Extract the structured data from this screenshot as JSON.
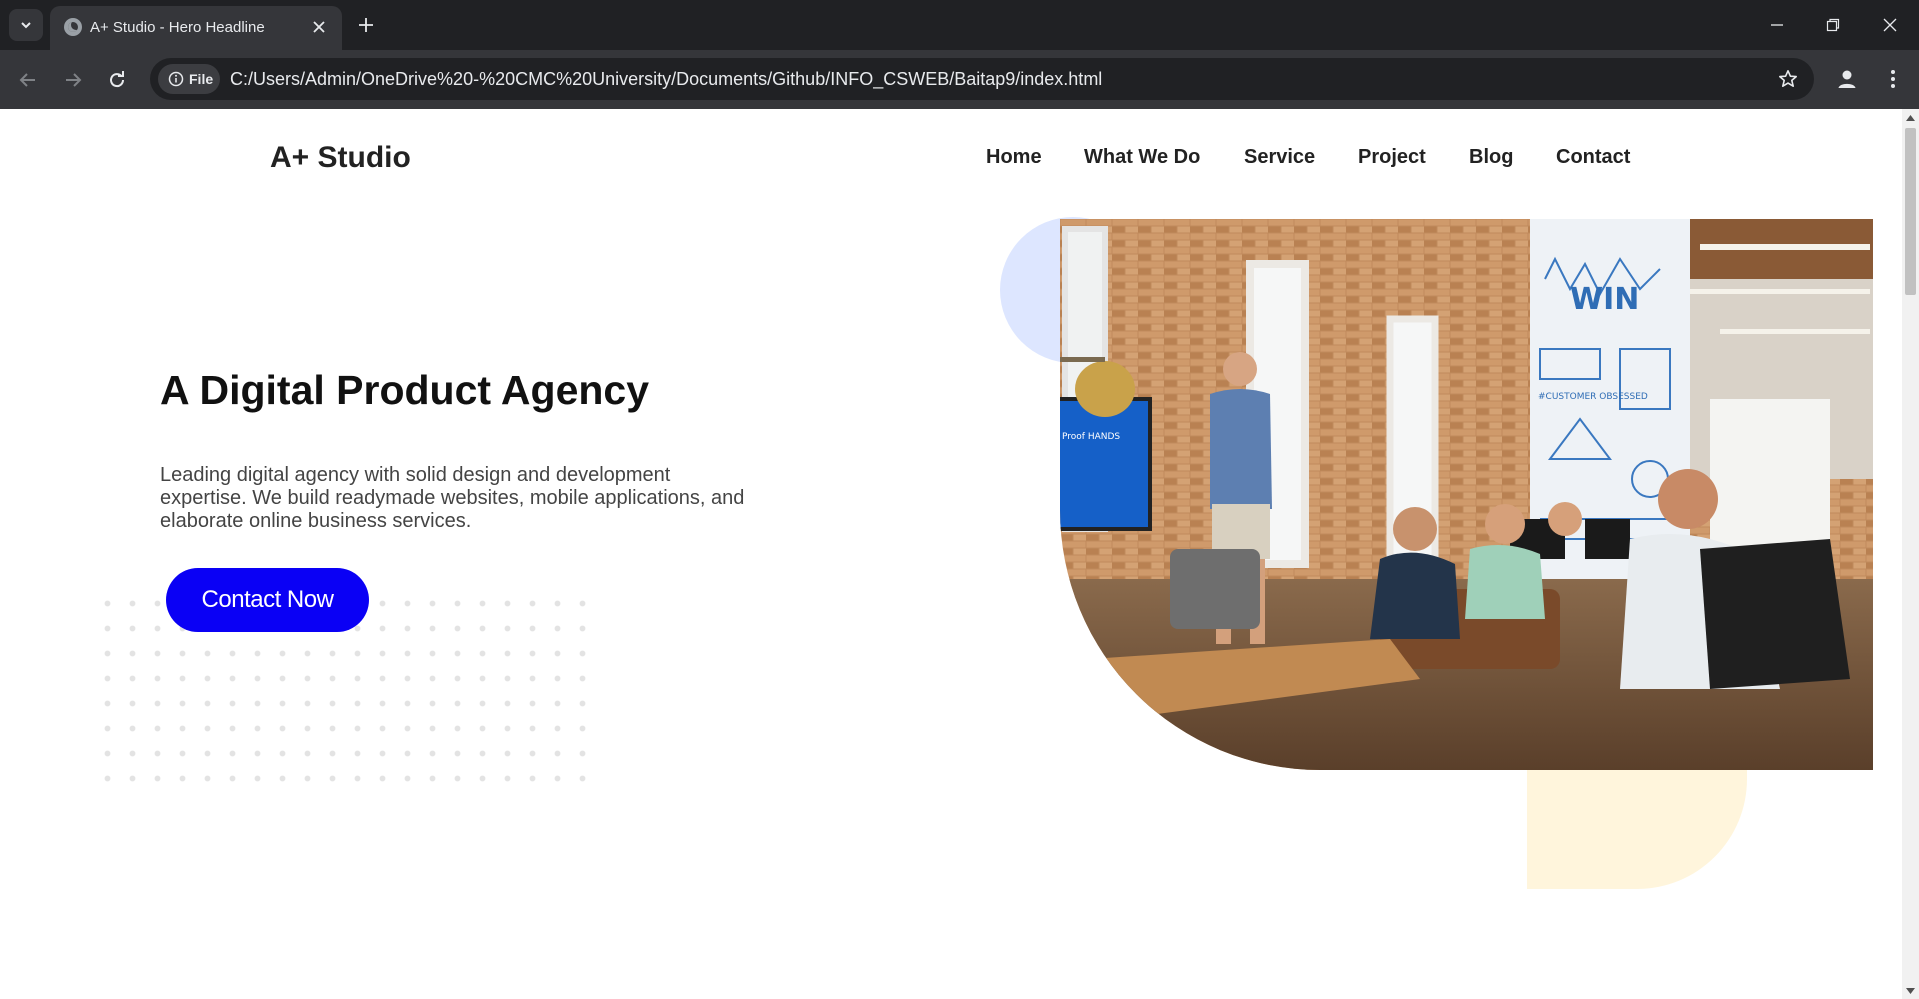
{
  "browser": {
    "tab_title": "A+ Studio - Hero Headline",
    "chip_label": "File",
    "url": "C:/Users/Admin/OneDrive%20-%20CMC%20University/Documents/Github/INFO_CSWEB/Baitap9/index.html",
    "icons": [
      "tab-search-icon",
      "globe-icon",
      "close-icon",
      "plus-icon",
      "minimize-icon",
      "restore-icon",
      "back-icon",
      "forward-icon",
      "reload-icon",
      "info-icon",
      "star-icon",
      "profile-icon",
      "more-vert-icon"
    ]
  },
  "page": {
    "brand": "A+ Studio",
    "nav": [
      {
        "label": "Home"
      },
      {
        "label": "What We Do"
      },
      {
        "label": "Service"
      },
      {
        "label": "Project"
      },
      {
        "label": "Blog"
      },
      {
        "label": "Contact"
      }
    ],
    "hero": {
      "title": "A Digital Product Agency",
      "description": "Leading digital agency with solid design and development expertise. We build readymade websites, mobile applications, and elaborate online business services.",
      "cta_label": "Contact Now",
      "image_sign_text": "WIN",
      "image_poster_text": "#CUSTOMER OBSESSED",
      "image_tv_text": "Proof HANDS"
    }
  },
  "colors": {
    "cta": "#0a00f5",
    "blob_blue": "#dde6ff",
    "blob_yellow": "#fff5dc",
    "chrome_dark": "#202124",
    "chrome_light": "#35363a"
  }
}
